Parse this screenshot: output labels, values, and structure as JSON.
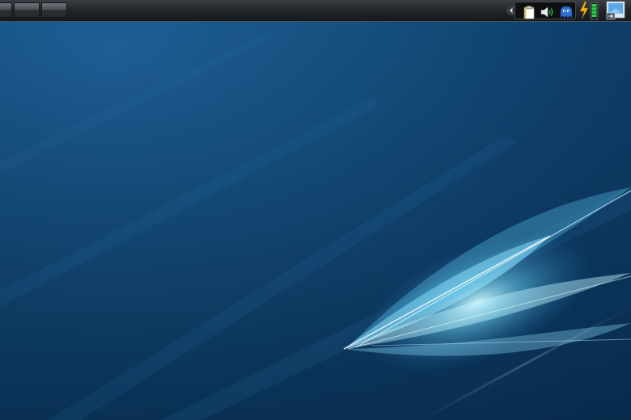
{
  "desktop": {
    "wallpaper": "blue-light-streaks",
    "colors": {
      "background": "#15507f",
      "panel": "#23272b",
      "glow": "#8ee6ff"
    }
  },
  "panel": {
    "pager_count": 3,
    "tray_icons": [
      "clipboard-icon",
      "volume-icon",
      "network-icon"
    ],
    "battery": {
      "icon": "battery-icon",
      "charging": true,
      "level": 0.8
    },
    "show_desktop_icon": "show-desktop-icon"
  }
}
